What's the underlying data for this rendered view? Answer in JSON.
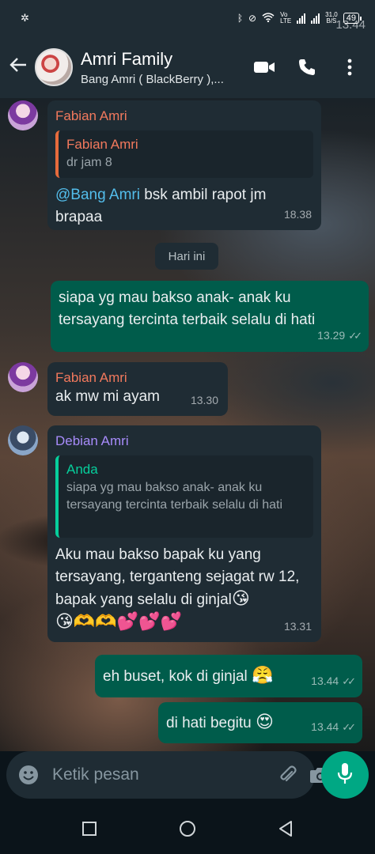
{
  "status_bar": {
    "time": "13.44",
    "network_speed_value": "31,0",
    "network_speed_unit": "B/S",
    "battery": "49"
  },
  "header": {
    "title": "Amri Family",
    "subtitle": "Bang Amri ( BlackBerry ),..."
  },
  "messages": [
    {
      "sender": "Fabian Amri",
      "quote_name": "Fabian Amri",
      "quote_text": "dr jam 8",
      "mention": "@Bang Amri",
      "text": " bsk ambil rapot jm brapaa",
      "time": "18.38"
    },
    {
      "date_chip": "Hari ini"
    },
    {
      "text": "siapa yg mau bakso anak- anak ku tersayang tercinta terbaik selalu di hati",
      "time": "13.29"
    },
    {
      "sender": "Fabian Amri",
      "text": "ak mw mi ayam",
      "time": "13.30"
    },
    {
      "sender": "Debian Amri",
      "quote_name": "Anda",
      "quote_text": "siapa yg mau bakso anak- anak ku tersayang tercinta terbaik selalu di hati",
      "text": "Aku mau bakso bapak ku yang tersayang, terganteng sejagat rw 12, bapak yang selalu di ginjal",
      "emoji_line": "😘🫶🫶💕💕💕",
      "emoji_inline": "😘",
      "time": "13.31"
    },
    {
      "text": "eh buset, kok di ginjal",
      "emoji": "😤",
      "time": "13.44"
    },
    {
      "text": "di hati begitu",
      "emoji": "😍",
      "time": "13.44"
    }
  ],
  "input": {
    "placeholder": "Ketik pesan"
  },
  "colors": {
    "header_bg": "#1f2c34",
    "incoming_bubble": "#1f2c34",
    "outgoing_bubble": "#005c4b",
    "accent": "#00a884",
    "sender_fabian": "#f2795d",
    "sender_debian": "#a78bfa",
    "mention": "#53bdeb"
  },
  "icons": [
    "back-arrow-icon",
    "video-call-icon",
    "phone-icon",
    "more-vert-icon",
    "emoji-icon",
    "attach-icon",
    "camera-icon",
    "mic-icon",
    "read-ticks-icon",
    "nav-recents-icon",
    "nav-home-icon",
    "nav-back-icon"
  ]
}
